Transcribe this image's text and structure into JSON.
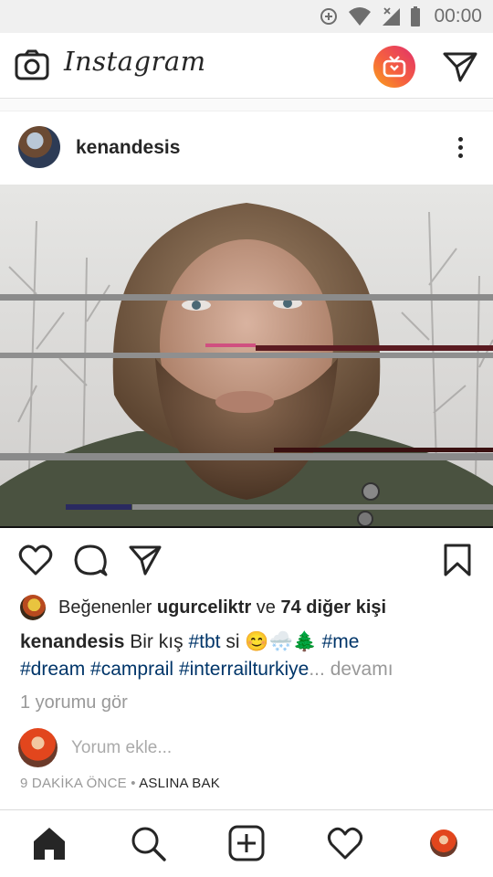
{
  "status_bar": {
    "time": "00:00",
    "icons": [
      "data-saver-icon",
      "wifi-icon",
      "cell-signal-icon",
      "battery-icon"
    ]
  },
  "app_bar": {
    "logo_text": "Instagram",
    "icons": [
      "camera-icon",
      "igtv-icon",
      "direct-message-icon"
    ],
    "igtv_gradient": [
      "#f9a21b",
      "#e1306c"
    ]
  },
  "post": {
    "username": "kenandesis",
    "likes": {
      "prefix": "Beğenenler",
      "first_liker": "ugurceliktr",
      "joiner": "ve",
      "others": "74 diğer kişi"
    },
    "caption": {
      "username": "kenandesis",
      "text_before": "Bir kış",
      "tag_tbt": "#tbt",
      "text_after": "si",
      "emojis": "😊🌨️🌲",
      "tag_me": "#me",
      "tag_dream": "#dream",
      "tag_camprail": "#camprail",
      "tag_interrail": "#interrailturkiye",
      "ellipsis": "...",
      "more": "devamı"
    },
    "view_comments": "1 yorumu gör",
    "comment_placeholder": "Yorum ekle...",
    "timestamp": "9 DAKİKA ÖNCE",
    "separator": "•",
    "see_translation": "ASLINA BAK"
  },
  "bottom_nav": {
    "items": [
      "home-icon",
      "search-icon",
      "new-post-icon",
      "activity-heart-icon",
      "profile-avatar"
    ]
  },
  "colors": {
    "hashtag": "#003569",
    "muted_text": "#999999",
    "text": "#262626"
  }
}
